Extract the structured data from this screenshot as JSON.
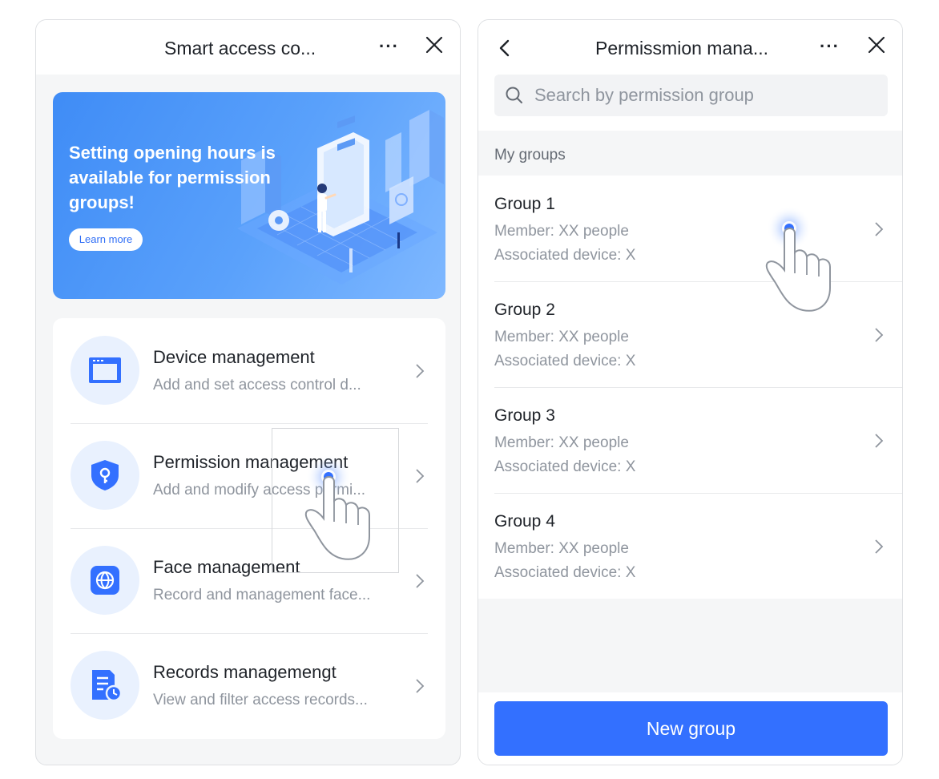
{
  "left_screen": {
    "title": "Smart access co...",
    "more_icon": "more-icon",
    "close_icon": "close-icon",
    "banner": {
      "title": "Setting opening hours is available for permission groups!",
      "button_label": "Learn more"
    },
    "menu": [
      {
        "title": "Device management",
        "subtitle": "Add and set access control d...",
        "icon": "device-icon"
      },
      {
        "title": "Permission management",
        "subtitle": "Add and modify access permi...",
        "icon": "shield-key-icon"
      },
      {
        "title": "Face management",
        "subtitle": "Record and management face...",
        "icon": "face-globe-icon"
      },
      {
        "title": "Records managemengt",
        "subtitle": "View and filter access records...",
        "icon": "records-clock-icon"
      }
    ]
  },
  "right_screen": {
    "title": "Permissmion mana...",
    "back_icon": "back-icon",
    "search": {
      "placeholder": "Search by permission group",
      "value": ""
    },
    "section_label": "My groups",
    "groups": [
      {
        "name": "Group 1",
        "member": "Member:  XX people",
        "device": "Associated device:  X"
      },
      {
        "name": "Group 2",
        "member": "Member:  XX people",
        "device": "Associated device:  X"
      },
      {
        "name": "Group 3",
        "member": "Member:  XX people",
        "device": "Associated device:  X"
      },
      {
        "name": "Group 4",
        "member": "Member:  XX people",
        "device": "Associated device:  X"
      }
    ],
    "new_group_label": "New group"
  },
  "colors": {
    "primary": "#3370ff",
    "banner": "#4a93f8",
    "icon_bg": "#e9f1fe",
    "text_secondary": "#8f959e"
  }
}
